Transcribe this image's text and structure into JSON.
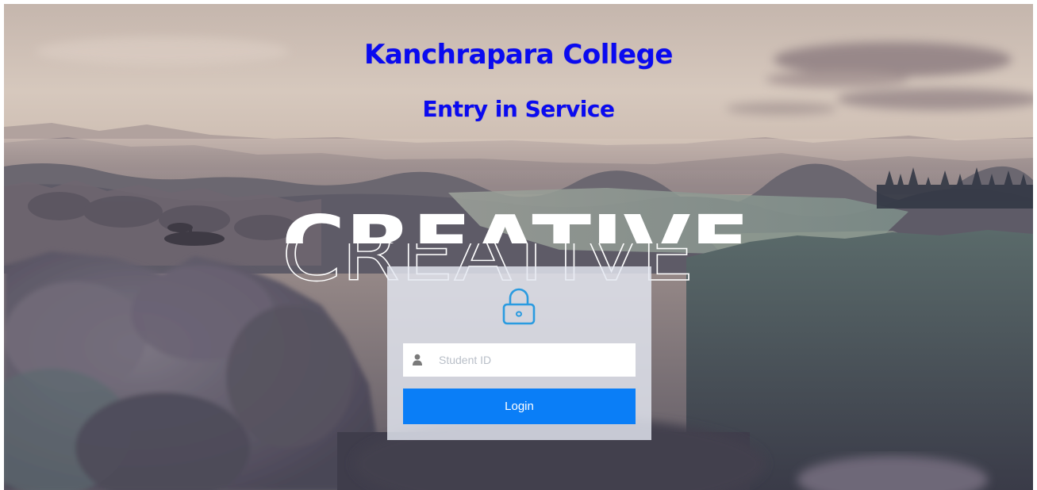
{
  "header": {
    "title": "Kanchrapara College",
    "subtitle": "Entry in Service"
  },
  "hero": {
    "overlay_text": "CREATIVE"
  },
  "login": {
    "icon": "lock-icon",
    "student_id": {
      "value": "",
      "placeholder": "Student ID",
      "icon": "user-icon"
    },
    "button_label": "Login"
  },
  "colors": {
    "title": "#0a0af0",
    "button": "#0a7ef7",
    "lock_icon": "#2a9be0",
    "panel": "#e4e8f2"
  }
}
